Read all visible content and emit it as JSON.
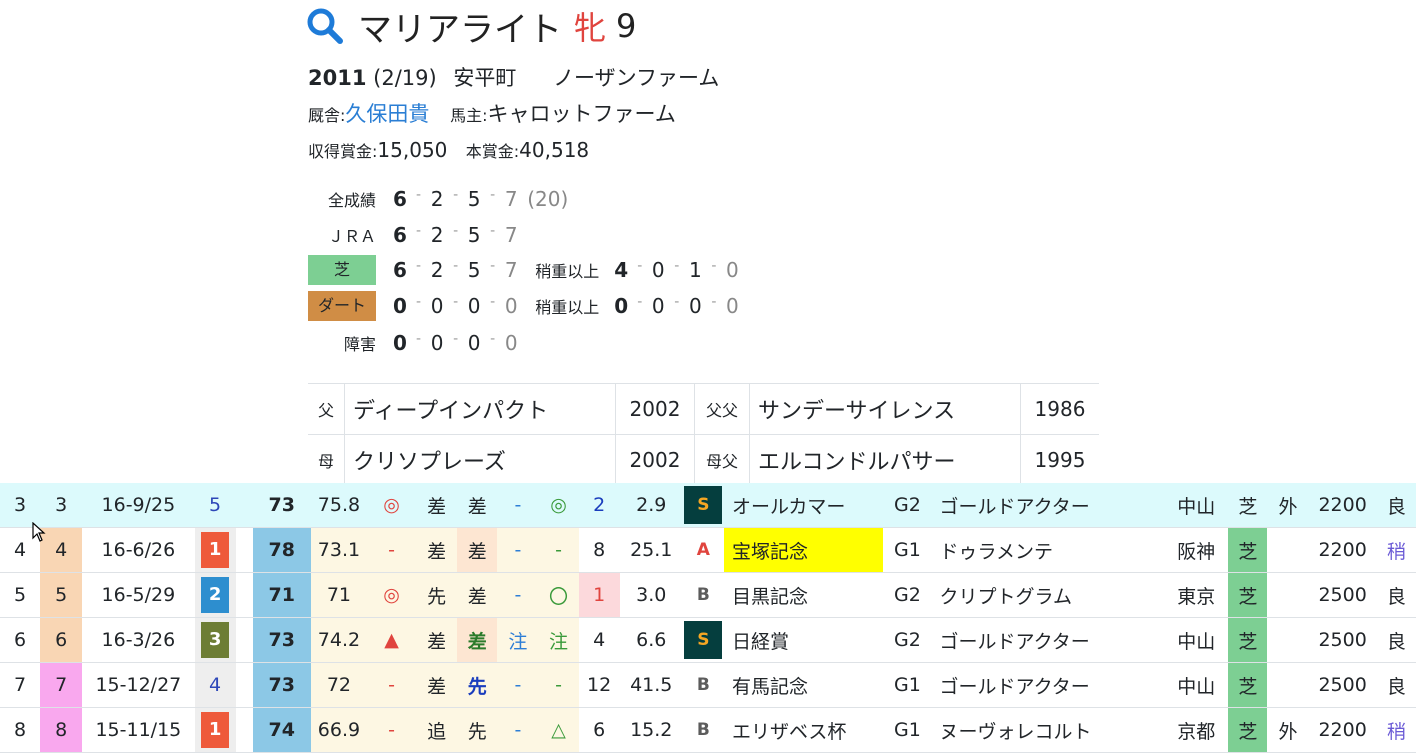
{
  "horse": {
    "name": "マリアライト",
    "sex": "牝",
    "age": "9"
  },
  "birth": {
    "year": "2011",
    "date": "(2/19)",
    "place": "安平町",
    "breeder": "ノーザンファーム"
  },
  "stable": {
    "trainer_label": "厩舎:",
    "trainer": "久保田貴",
    "owner_label": "馬主:",
    "owner": "キャロットファーム"
  },
  "prize": {
    "earned_label": "収得賞金:",
    "earned": "15,050",
    "main_label": "本賞金:",
    "main": "40,518"
  },
  "records": [
    {
      "label": "全成績",
      "nums": [
        "6",
        "2",
        "5",
        "7"
      ],
      "total": "(20)"
    },
    {
      "label": "ＪＲＡ",
      "nums": [
        "6",
        "2",
        "5",
        "7"
      ]
    },
    {
      "label": "芝",
      "nums": [
        "6",
        "2",
        "5",
        "7"
      ],
      "heavy_label": "稍重以上",
      "heavy": [
        "4",
        "0",
        "1",
        "0"
      ]
    },
    {
      "label": "ダート",
      "nums": [
        "0",
        "0",
        "0",
        "0"
      ],
      "heavy_label": "稍重以上",
      "heavy": [
        "0",
        "0",
        "0",
        "0"
      ]
    },
    {
      "label": "障害",
      "nums": [
        "0",
        "0",
        "0",
        "0"
      ]
    }
  ],
  "pedigree": {
    "sire_label": "父",
    "sire": "ディープインパクト",
    "sire_year": "2002",
    "sire_sire_label": "父父",
    "sire_sire": "サンデーサイレンス",
    "sire_sire_year": "1986",
    "dam_label": "母",
    "dam": "クリソプレーズ",
    "dam_year": "2002",
    "dam_sire_label": "母父",
    "dam_sire": "エルコンドルパサー",
    "dam_sire_year": "1995"
  },
  "races": [
    {
      "no": "3",
      "gate": "3",
      "date": "16-9/25",
      "waku": "5",
      "index": "73",
      "score": "75.8",
      "mark": "◎",
      "style": "差",
      "style2": "差",
      "c1": "-",
      "c2": "◎",
      "pop": "2",
      "odds": "2.9",
      "level": "S",
      "race": "オールカマー",
      "grade": "G2",
      "winner": "ゴールドアクター",
      "course": "中山",
      "surface": "芝",
      "inout": "外",
      "dist": "2200",
      "going": "良"
    },
    {
      "no": "4",
      "gate": "4",
      "date": "16-6/26",
      "waku": "1",
      "index": "78",
      "score": "73.1",
      "mark": "-",
      "style": "差",
      "style2": "差",
      "c1": "-",
      "c2": "-",
      "pop": "8",
      "odds": "25.1",
      "level": "A",
      "race": "宝塚記念",
      "grade": "G1",
      "winner": "ドゥラメンテ",
      "course": "阪神",
      "surface": "芝",
      "inout": "",
      "dist": "2200",
      "going": "稍"
    },
    {
      "no": "5",
      "gate": "5",
      "date": "16-5/29",
      "waku": "2",
      "index": "71",
      "score": "71",
      "mark": "◎",
      "style": "先",
      "style2": "差",
      "c1": "-",
      "c2": "〇",
      "pop": "1",
      "odds": "3.0",
      "level": "B",
      "race": "目黒記念",
      "grade": "G2",
      "winner": "クリプトグラム",
      "course": "東京",
      "surface": "芝",
      "inout": "",
      "dist": "2500",
      "going": "良"
    },
    {
      "no": "6",
      "gate": "6",
      "date": "16-3/26",
      "waku": "3",
      "index": "73",
      "score": "74.2",
      "mark": "▲",
      "style": "差",
      "style2": "差",
      "c1": "注",
      "c2": "注",
      "pop": "4",
      "odds": "6.6",
      "level": "S",
      "race": "日経賞",
      "grade": "G2",
      "winner": "ゴールドアクター",
      "course": "中山",
      "surface": "芝",
      "inout": "",
      "dist": "2500",
      "going": "良"
    },
    {
      "no": "7",
      "gate": "7",
      "date": "15-12/27",
      "waku": "4",
      "index": "73",
      "score": "72",
      "mark": "-",
      "style": "差",
      "style2": "先",
      "c1": "-",
      "c2": "-",
      "pop": "12",
      "odds": "41.5",
      "level": "B",
      "race": "有馬記念",
      "grade": "G1",
      "winner": "ゴールドアクター",
      "course": "中山",
      "surface": "芝",
      "inout": "",
      "dist": "2500",
      "going": "良"
    },
    {
      "no": "8",
      "gate": "8",
      "date": "15-11/15",
      "waku": "1",
      "index": "74",
      "score": "66.9",
      "mark": "-",
      "style": "追",
      "style2": "先",
      "c1": "-",
      "c2": "△",
      "pop": "6",
      "odds": "15.2",
      "level": "B",
      "race": "エリザベス杯",
      "grade": "G1",
      "winner": "ヌーヴォレコルト",
      "course": "京都",
      "surface": "芝",
      "inout": "外",
      "dist": "2200",
      "going": "稍"
    }
  ]
}
